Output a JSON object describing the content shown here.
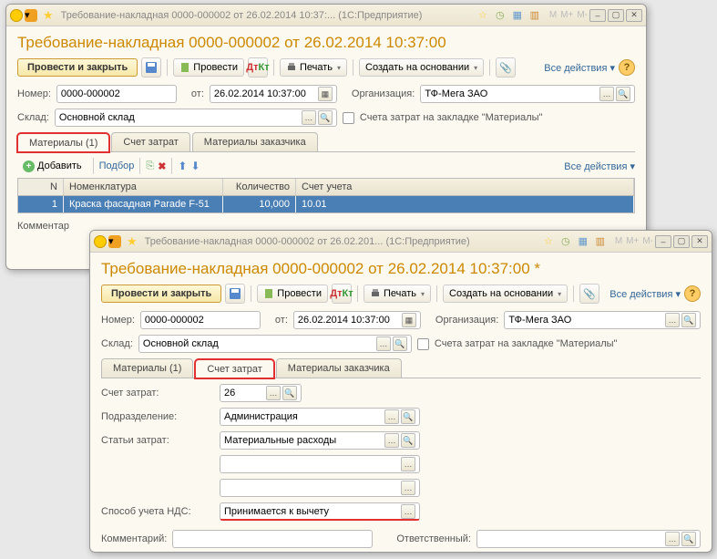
{
  "win1": {
    "title": "Требование-накладная 0000-000002 от 26.02.2014 10:37:...   (1С:Предприятие)",
    "doctitle": "Требование-накладная 0000-000002 от 26.02.2014 10:37:00",
    "primary": "Провести и закрыть",
    "post": "Провести",
    "print": "Печать",
    "createbase": "Создать на основании",
    "allactions": "Все действия",
    "lbl_num": "Номер:",
    "num": "0000-000002",
    "lbl_from": "от:",
    "date": "26.02.2014 10:37:00",
    "lbl_org": "Организация:",
    "org": "ТФ-Мега ЗАО",
    "lbl_store": "Склад:",
    "store": "Основной склад",
    "chk": "Счета затрат на закладке \"Материалы\"",
    "tab1": "Материалы (1)",
    "tab2": "Счет затрат",
    "tab3": "Материалы заказчика",
    "add": "Добавить",
    "pick": "Подбор",
    "col_n": "N",
    "col_nom": "Номенклатура",
    "col_qty": "Количество",
    "col_acc": "Счет учета",
    "row_n": "1",
    "row_nom": "Краска фасадная Parade F-51",
    "row_qty": "10,000",
    "row_acc": "10.01",
    "comment": "Комментар"
  },
  "win2": {
    "title": "Требование-накладная 0000-000002 от 26.02.201...   (1С:Предприятие)",
    "doctitle": "Требование-накладная 0000-000002 от 26.02.2014 10:37:00 *",
    "primary": "Провести и закрыть",
    "post": "Провести",
    "print": "Печать",
    "createbase": "Создать на основании",
    "allactions": "Все действия",
    "lbl_num": "Номер:",
    "num": "0000-000002",
    "lbl_from": "от:",
    "date": "26.02.2014 10:37:00",
    "lbl_org": "Организация:",
    "org": "ТФ-Мега ЗАО",
    "lbl_store": "Склад:",
    "store": "Основной склад",
    "chk": "Счета затрат на закладке \"Материалы\"",
    "tab1": "Материалы (1)",
    "tab2": "Счет затрат",
    "tab3": "Материалы заказчика",
    "lbl_costacc": "Счет затрат:",
    "costacc": "26",
    "lbl_dept": "Подразделение:",
    "dept": "Администрация",
    "lbl_art": "Статьи затрат:",
    "art": "Материальные расходы",
    "lbl_vat": "Способ учета НДС:",
    "vat": "Принимается к вычету",
    "lbl_comment": "Комментарий:",
    "lbl_resp": "Ответственный:"
  }
}
